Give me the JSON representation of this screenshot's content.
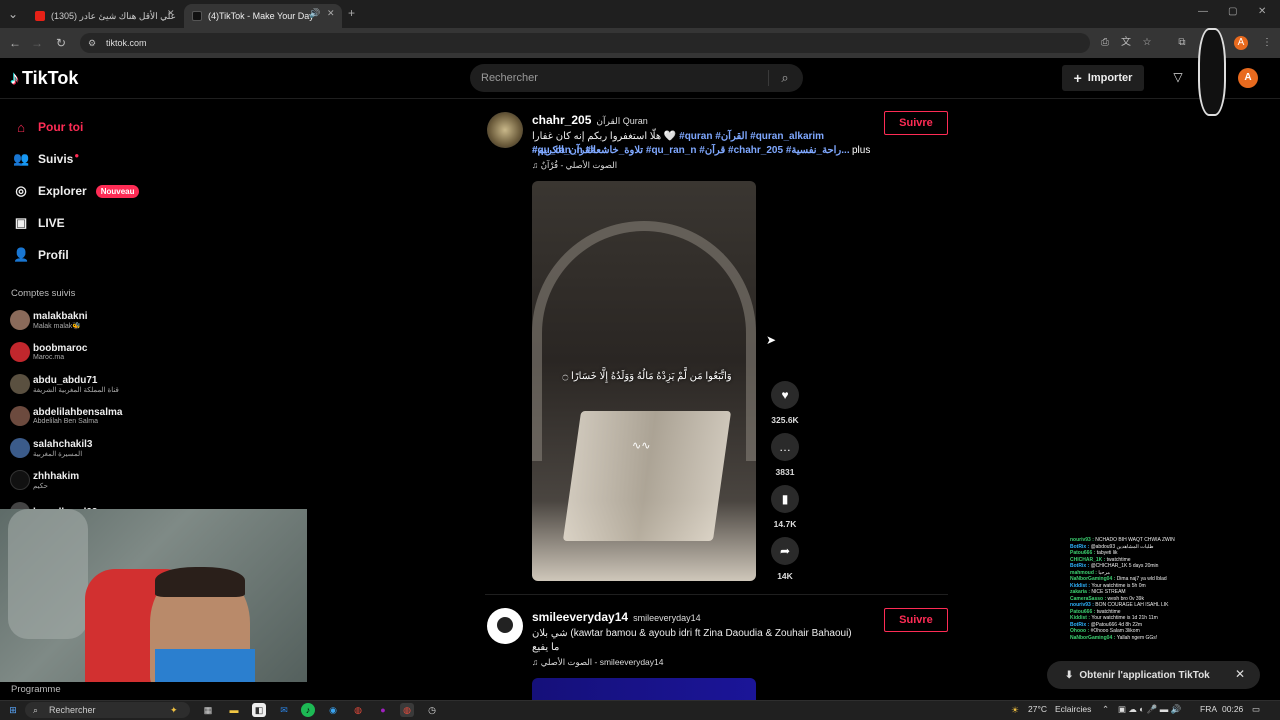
{
  "browser": {
    "tabs": [
      {
        "title": "(1305) علي الأقل هناك شيئ‌ عادر",
        "active": false
      },
      {
        "title": "(4)TikTok - Make Your Day",
        "active": true
      }
    ],
    "url": "tiktok.com"
  },
  "header": {
    "logo": "TikTok",
    "search_placeholder": "Rechercher",
    "import_label": "Importer",
    "avatar_letter": "A"
  },
  "sidebar": {
    "nav": [
      {
        "label": "Pour toi",
        "icon": "home-icon"
      },
      {
        "label": "Suivis",
        "icon": "users-icon"
      },
      {
        "label": "Explorer",
        "icon": "compass-icon",
        "badge": "Nouveau"
      },
      {
        "label": "LIVE",
        "icon": "live-icon"
      },
      {
        "label": "Profil",
        "icon": "profile-icon"
      }
    ],
    "followed_title": "Comptes suivis",
    "accounts": [
      {
        "username": "malakbakni",
        "display": "Malak malak🐝"
      },
      {
        "username": "boobmaroc",
        "display": "Maroc.ma"
      },
      {
        "username": "abdu_abdu71",
        "display": "قناة المملكة المغربية الشريفة"
      },
      {
        "username": "abdelilahbensalma",
        "display": "Abdelilah Ben Salma"
      },
      {
        "username": "salahchakil3",
        "display": "المسيرة المغربية"
      },
      {
        "username": "zhhhakim",
        "display": "حكيم"
      },
      {
        "username": "kamallowal03",
        "display": ""
      }
    ],
    "programme_label": "Programme"
  },
  "posts": [
    {
      "username": "chahr_205",
      "subname": "القرآن Quran",
      "desc_line1": "هلّا استغفروا ربكم إنه كان غفارا 🤍",
      "tags_line1": "#quran #القرآن #quran_alkarim #القرآن_الكريم",
      "tags_line2": "#qu_ran_n #تلاوة_خاشعة #qu_ran_n #قرآن #chahr_205 #راحة_نفسية...",
      "more": "plus",
      "music": "♫ الصوت الأصلي - قُرْآنٌ",
      "follow": "Suivre",
      "overlay_text": "وَاتَّبَعُوا مَن لَّمْ يَزِدْهُ مَالُهُ وَوَلَدُهُ إِلَّا خَسَارًا ۝",
      "actions": [
        {
          "icon": "heart-icon",
          "count": "325.6K"
        },
        {
          "icon": "comment-icon",
          "count": "3831"
        },
        {
          "icon": "bookmark-icon",
          "count": "14.7K"
        },
        {
          "icon": "share-icon",
          "count": "14K"
        }
      ]
    },
    {
      "username": "smileeveryday14",
      "subname": "smileeveryday14",
      "desc_line1": "شي بلان (kawtar bamou & ayoub idri ft Zina Daoudia & Zouhair Bahaoui)",
      "desc_line2": "ما يفيع",
      "music": "♫ الصوت الأصلي - smileeveryday14",
      "follow": "Suivre"
    }
  ],
  "chat": [
    {
      "user": "nouriv93",
      "msg": "NCHADO BIH WAQT CHWIA ZWIN"
    },
    {
      "user": "BotRix",
      "msg": "@abdou93 طلبات المشاهدين"
    },
    {
      "user": "Patou666",
      "msg": "tabyeti lik"
    },
    {
      "user": "CHICHAR_1K",
      "msg": "twatchtime"
    },
    {
      "user": "BotRix",
      "msg": "@CHICHAR_1K 5 days 20min"
    },
    {
      "user": "mahmoud",
      "msg": "مرحبا"
    },
    {
      "user": "NaNborGaming04",
      "msg": "Dima naj7 ya wld lblad"
    },
    {
      "user": "Kiddist",
      "msg": "Your watchtime is 5h 0m"
    },
    {
      "user": "zakaria",
      "msg": "NICE STREAM"
    },
    {
      "user": "CameraSasso",
      "msg": "wesh bro 0v 39k"
    },
    {
      "user": "nouriv93",
      "msg": "BON COURAGE LAH ISAHL LIK"
    },
    {
      "user": "Patou666",
      "msg": "twatchtime"
    },
    {
      "user": "Kiddist",
      "msg": "Your watchtime is 1d 21h 11m"
    },
    {
      "user": "BotRix",
      "msg": "@Patou666 4d 8h 22m"
    },
    {
      "user": "Ohooo",
      "msg": "#Ohooo Salam 3likom"
    },
    {
      "user": "NaNborGaming04",
      "msg": "Yallah ngem GGs!"
    }
  ],
  "get_app_label": "Obtenir l'application TikTok",
  "taskbar": {
    "search_label": "Rechercher",
    "weather": "27°C",
    "weather_desc": "Eclaircies",
    "lang": "FRA",
    "time": "00:26"
  },
  "colors": {
    "accent": "#fe2c55",
    "background": "#000000",
    "hashtag": "#7fa8ff"
  }
}
